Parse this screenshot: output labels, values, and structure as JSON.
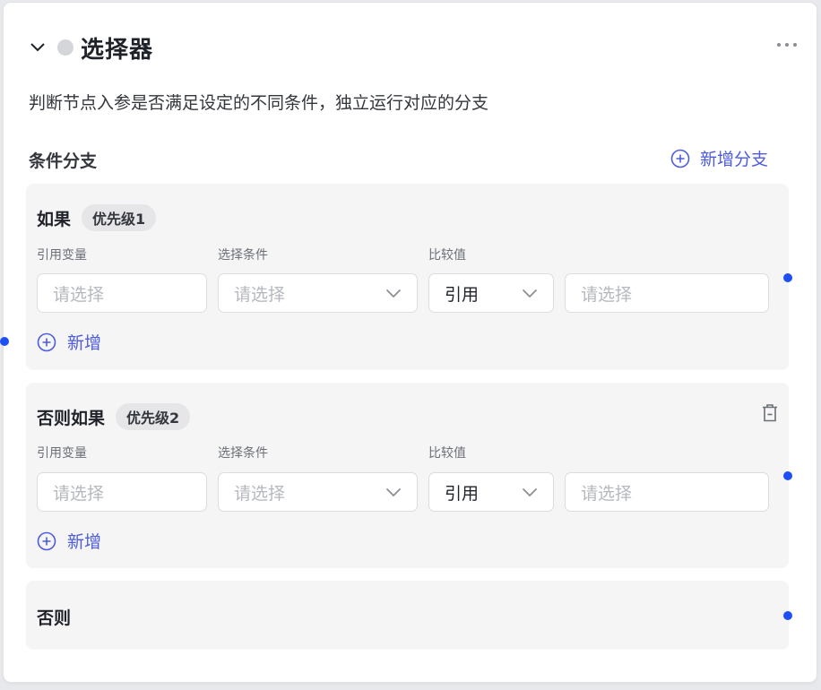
{
  "node": {
    "title": "选择器",
    "description": "判断节点入参是否满足设定的不同条件，独立运行对应的分支"
  },
  "section": {
    "title": "条件分支",
    "add_branch_label": "新增分支"
  },
  "branches": [
    {
      "title": "如果",
      "priority": "优先级1",
      "labels": {
        "variable": "引用变量",
        "condition": "选择条件",
        "compare": "比较值"
      },
      "variable_placeholder": "请选择",
      "condition_placeholder": "请选择",
      "compare_type": "引用",
      "compare_placeholder": "请选择",
      "add_label": "新增"
    },
    {
      "title": "否则如果",
      "priority": "优先级2",
      "labels": {
        "variable": "引用变量",
        "condition": "选择条件",
        "compare": "比较值"
      },
      "variable_placeholder": "请选择",
      "condition_placeholder": "请选择",
      "compare_type": "引用",
      "compare_placeholder": "请选择",
      "add_label": "新增"
    },
    {
      "title": "否则"
    }
  ],
  "icons": {
    "collapse": "chevron-down-icon",
    "more": "more-horizontal-icon",
    "add": "plus-circle-icon",
    "dropdown": "chevron-down-icon",
    "delete": "trash-icon"
  },
  "colors": {
    "accent": "#4d5bdf",
    "port": "#1d4ff5",
    "branch_bg": "#f5f5f6"
  }
}
